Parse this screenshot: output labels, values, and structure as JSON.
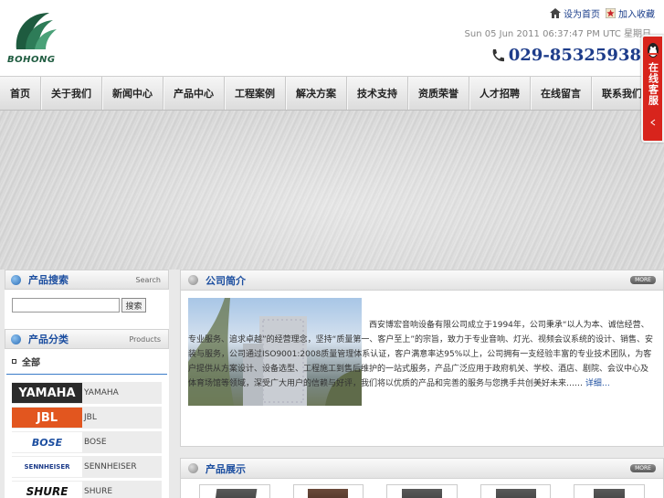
{
  "header": {
    "logo_text": "BOHONG",
    "top_links": [
      {
        "icon": "home-icon",
        "label": "设为首页"
      },
      {
        "icon": "star-icon",
        "label": "加入收藏"
      }
    ],
    "datetime": "Sun 05 Jun 2011 06:37:47 PM UTC 星期日",
    "phone": "029-85325938",
    "colors": {
      "brand": "#1d3c8a",
      "accent_red": "#d8241c"
    }
  },
  "nav": {
    "items": [
      "首页",
      "关于我们",
      "新闻中心",
      "产品中心",
      "工程案例",
      "解决方案",
      "技术支持",
      "资质荣誉",
      "人才招聘",
      "在线留言",
      "联系我们"
    ]
  },
  "online_service": {
    "label": "在线客服",
    "icon": "qq-penguin-icon"
  },
  "sidebar": {
    "search": {
      "title": "产品搜索",
      "subtitle": "Search",
      "button": "搜索",
      "placeholder": ""
    },
    "products": {
      "title": "产品分类",
      "subtitle": "Products",
      "all_label": "全部",
      "brands": [
        {
          "name": "YAMAHA",
          "logo_text": "YAMAHA",
          "logo_bg": "#2b2b2b"
        },
        {
          "name": "JBL",
          "logo_text": "JBL",
          "logo_bg": "#e2561f"
        },
        {
          "name": "BOSE",
          "logo_text": "BOSE",
          "logo_bg": "#1d4fa0"
        },
        {
          "name": "SENNHEISER",
          "logo_text": "SENNHEISER",
          "logo_bg": "#2a2a2a"
        },
        {
          "name": "SHURE",
          "logo_text": "SHURE",
          "logo_bg": "#2b2b2b"
        }
      ]
    }
  },
  "about": {
    "title": "公司简介",
    "more": "MORE",
    "text": "西安博宏音响设备有限公司成立于1994年，公司秉承“以人为本、诚信经营、专业服务、追求卓越”的经营理念，坚持“质量第一、客户至上”的宗旨，致力于专业音响、灯光、视频会议系统的设计、销售、安装与服务，公司通过ISO9001:2008质量管理体系认证，客户满意率达95%以上，公司拥有一支经验丰富的专业技术团队，为客户提供从方案设计、设备选型、工程施工到售后维护的一站式服务，产品广泛应用于政府机关、学校、酒店、剧院、会议中心及体育场馆等领域，深受广大用户的信赖与好评，我们将以优质的产品和完善的服务与您携手共创美好未来……",
    "more_link": "详细…"
  },
  "products_section": {
    "title": "产品展示",
    "more": "MORE",
    "items": [
      "product-1",
      "product-2",
      "product-3",
      "product-4",
      "product-5"
    ]
  }
}
